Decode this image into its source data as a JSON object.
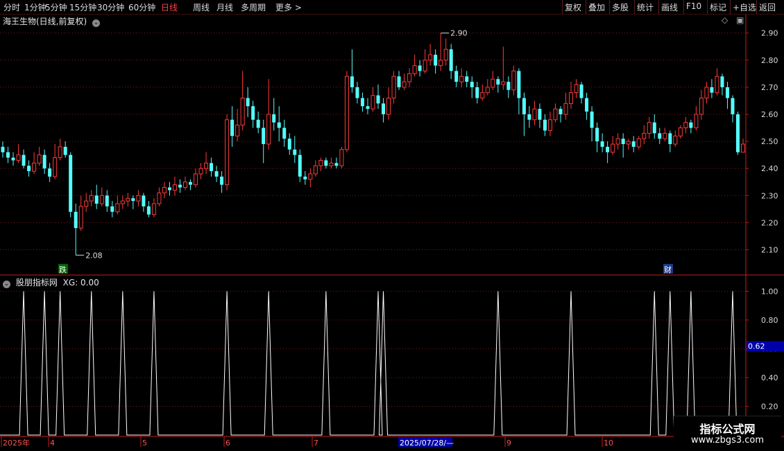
{
  "toolbar": {
    "periods": [
      "分时",
      "1分钟",
      "5分钟",
      "15分钟",
      "30分钟",
      "60分钟",
      "日线",
      "周线",
      "月线",
      "多周期",
      "更多 >"
    ],
    "active_period": "日线",
    "tools": [
      "复权",
      "叠加",
      "多股",
      "统计",
      "画线",
      "F10",
      "标记",
      "+自选",
      "返回"
    ]
  },
  "main_panel": {
    "title": "海王生物(日线,前复权)",
    "high_marker": "2.90",
    "low_marker": "2.08",
    "badge_left": "跌",
    "badge_right": "财"
  },
  "sub_panel": {
    "title": "股朋指标网",
    "indicator": "XG: 0.00",
    "cursor_value": "0.62"
  },
  "time_axis": {
    "labels": [
      "2025年",
      "4",
      "5",
      "6",
      "7",
      "9",
      "10"
    ],
    "cursor_date": "2025/07/28/—"
  },
  "watermark": {
    "line1": "指标公式网",
    "line2": "www.zbgs3.com"
  },
  "colors": {
    "up": "#ff3b3b",
    "down": "#54ffff",
    "grid": "#8b1a1a",
    "axis": "#c81e1e",
    "indicator": "#ffffff",
    "cursor_bg": "#0000aa"
  },
  "chart_data": [
    {
      "type": "candlestick",
      "title": "海王生物(日线,前复权)",
      "ylim": [
        2.05,
        2.93
      ],
      "y_ticks": [
        "2.10",
        "2.20",
        "2.30",
        "2.40",
        "2.50",
        "2.60",
        "2.70",
        "2.80",
        "2.90"
      ],
      "x_ticks": [
        "2025年",
        "4",
        "5",
        "6",
        "7",
        "9",
        "10"
      ],
      "high": 2.9,
      "low": 2.08,
      "candles": [
        [
          2.48,
          2.46,
          2.5,
          2.44
        ],
        [
          2.46,
          2.44,
          2.48,
          2.42
        ],
        [
          2.44,
          2.43,
          2.46,
          2.41
        ],
        [
          2.43,
          2.45,
          2.49,
          2.42
        ],
        [
          2.45,
          2.41,
          2.47,
          2.4
        ],
        [
          2.41,
          2.39,
          2.43,
          2.37
        ],
        [
          2.39,
          2.42,
          2.46,
          2.38
        ],
        [
          2.42,
          2.45,
          2.48,
          2.41
        ],
        [
          2.45,
          2.4,
          2.47,
          2.38
        ],
        [
          2.4,
          2.37,
          2.42,
          2.35
        ],
        [
          2.37,
          2.44,
          2.49,
          2.36
        ],
        [
          2.44,
          2.48,
          2.51,
          2.43
        ],
        [
          2.48,
          2.45,
          2.5,
          2.44
        ],
        [
          2.45,
          2.24,
          2.46,
          2.22
        ],
        [
          2.24,
          2.18,
          2.27,
          2.08
        ],
        [
          2.18,
          2.26,
          2.3,
          2.17
        ],
        [
          2.26,
          2.28,
          2.31,
          2.24
        ],
        [
          2.28,
          2.3,
          2.32,
          2.26
        ],
        [
          2.3,
          2.27,
          2.34,
          2.25
        ],
        [
          2.27,
          2.3,
          2.33,
          2.26
        ],
        [
          2.3,
          2.26,
          2.32,
          2.24
        ],
        [
          2.26,
          2.24,
          2.28,
          2.22
        ],
        [
          2.24,
          2.27,
          2.3,
          2.23
        ],
        [
          2.27,
          2.28,
          2.3,
          2.25
        ],
        [
          2.28,
          2.29,
          2.31,
          2.26
        ],
        [
          2.29,
          2.28,
          2.3,
          2.25
        ],
        [
          2.28,
          2.3,
          2.32,
          2.26
        ],
        [
          2.3,
          2.26,
          2.31,
          2.24
        ],
        [
          2.26,
          2.23,
          2.28,
          2.22
        ],
        [
          2.23,
          2.27,
          2.29,
          2.22
        ],
        [
          2.27,
          2.31,
          2.33,
          2.26
        ],
        [
          2.31,
          2.33,
          2.35,
          2.29
        ],
        [
          2.33,
          2.32,
          2.35,
          2.3
        ],
        [
          2.32,
          2.34,
          2.37,
          2.3
        ],
        [
          2.34,
          2.33,
          2.36,
          2.31
        ],
        [
          2.33,
          2.35,
          2.37,
          2.32
        ],
        [
          2.35,
          2.34,
          2.36,
          2.32
        ],
        [
          2.34,
          2.38,
          2.4,
          2.33
        ],
        [
          2.38,
          2.4,
          2.42,
          2.36
        ],
        [
          2.4,
          2.42,
          2.46,
          2.38
        ],
        [
          2.42,
          2.39,
          2.44,
          2.37
        ],
        [
          2.39,
          2.37,
          2.41,
          2.35
        ],
        [
          2.37,
          2.34,
          2.39,
          2.31
        ],
        [
          2.34,
          2.58,
          2.6,
          2.32
        ],
        [
          2.58,
          2.52,
          2.63,
          2.48
        ],
        [
          2.52,
          2.56,
          2.62,
          2.5
        ],
        [
          2.56,
          2.66,
          2.76,
          2.54
        ],
        [
          2.66,
          2.63,
          2.7,
          2.59
        ],
        [
          2.63,
          2.58,
          2.65,
          2.55
        ],
        [
          2.58,
          2.55,
          2.61,
          2.53
        ],
        [
          2.55,
          2.49,
          2.58,
          2.42
        ],
        [
          2.49,
          2.6,
          2.73,
          2.47
        ],
        [
          2.6,
          2.57,
          2.66,
          2.54
        ],
        [
          2.57,
          2.55,
          2.63,
          2.5
        ],
        [
          2.55,
          2.51,
          2.58,
          2.48
        ],
        [
          2.51,
          2.47,
          2.53,
          2.45
        ],
        [
          2.47,
          2.45,
          2.52,
          2.42
        ],
        [
          2.45,
          2.37,
          2.47,
          2.35
        ],
        [
          2.37,
          2.36,
          2.39,
          2.34
        ],
        [
          2.36,
          2.38,
          2.4,
          2.33
        ],
        [
          2.38,
          2.41,
          2.43,
          2.37
        ],
        [
          2.41,
          2.43,
          2.44,
          2.39
        ],
        [
          2.43,
          2.41,
          2.44,
          2.4
        ],
        [
          2.41,
          2.42,
          2.44,
          2.4
        ],
        [
          2.42,
          2.41,
          2.44,
          2.4
        ],
        [
          2.41,
          2.47,
          2.48,
          2.4
        ],
        [
          2.47,
          2.74,
          2.76,
          2.46
        ],
        [
          2.74,
          2.7,
          2.84,
          2.68
        ],
        [
          2.7,
          2.66,
          2.72,
          2.64
        ],
        [
          2.66,
          2.63,
          2.68,
          2.61
        ],
        [
          2.63,
          2.62,
          2.66,
          2.6
        ],
        [
          2.62,
          2.67,
          2.7,
          2.61
        ],
        [
          2.67,
          2.64,
          2.71,
          2.62
        ],
        [
          2.64,
          2.6,
          2.66,
          2.57
        ],
        [
          2.6,
          2.66,
          2.7,
          2.58
        ],
        [
          2.66,
          2.74,
          2.76,
          2.64
        ],
        [
          2.74,
          2.7,
          2.76,
          2.69
        ],
        [
          2.7,
          2.72,
          2.75,
          2.69
        ],
        [
          2.72,
          2.75,
          2.77,
          2.7
        ],
        [
          2.75,
          2.78,
          2.82,
          2.74
        ],
        [
          2.78,
          2.76,
          2.8,
          2.74
        ],
        [
          2.76,
          2.8,
          2.84,
          2.75
        ],
        [
          2.8,
          2.82,
          2.86,
          2.78
        ],
        [
          2.82,
          2.78,
          2.84,
          2.75
        ],
        [
          2.78,
          2.8,
          2.9,
          2.76
        ],
        [
          2.8,
          2.84,
          2.88,
          2.78
        ],
        [
          2.84,
          2.76,
          2.86,
          2.73
        ],
        [
          2.76,
          2.72,
          2.78,
          2.7
        ],
        [
          2.72,
          2.74,
          2.77,
          2.7
        ],
        [
          2.74,
          2.72,
          2.76,
          2.7
        ],
        [
          2.72,
          2.7,
          2.74,
          2.66
        ],
        [
          2.7,
          2.66,
          2.72,
          2.64
        ],
        [
          2.66,
          2.68,
          2.71,
          2.65
        ],
        [
          2.68,
          2.7,
          2.73,
          2.67
        ],
        [
          2.7,
          2.73,
          2.76,
          2.69
        ],
        [
          2.73,
          2.71,
          2.74,
          2.68
        ],
        [
          2.71,
          2.72,
          2.85,
          2.69
        ],
        [
          2.72,
          2.69,
          2.74,
          2.66
        ],
        [
          2.69,
          2.76,
          2.78,
          2.67
        ],
        [
          2.76,
          2.66,
          2.77,
          2.6
        ],
        [
          2.66,
          2.6,
          2.68,
          2.52
        ],
        [
          2.6,
          2.58,
          2.63,
          2.55
        ],
        [
          2.58,
          2.62,
          2.65,
          2.56
        ],
        [
          2.62,
          2.58,
          2.64,
          2.55
        ],
        [
          2.58,
          2.54,
          2.6,
          2.52
        ],
        [
          2.54,
          2.58,
          2.61,
          2.52
        ],
        [
          2.58,
          2.62,
          2.64,
          2.57
        ],
        [
          2.62,
          2.6,
          2.63,
          2.57
        ],
        [
          2.6,
          2.64,
          2.68,
          2.58
        ],
        [
          2.64,
          2.68,
          2.72,
          2.62
        ],
        [
          2.68,
          2.71,
          2.73,
          2.66
        ],
        [
          2.71,
          2.66,
          2.72,
          2.64
        ],
        [
          2.66,
          2.61,
          2.68,
          2.58
        ],
        [
          2.61,
          2.55,
          2.63,
          2.5
        ],
        [
          2.55,
          2.5,
          2.57,
          2.46
        ],
        [
          2.5,
          2.48,
          2.53,
          2.46
        ],
        [
          2.48,
          2.46,
          2.5,
          2.42
        ],
        [
          2.46,
          2.49,
          2.52,
          2.45
        ],
        [
          2.49,
          2.51,
          2.53,
          2.47
        ],
        [
          2.51,
          2.49,
          2.53,
          2.44
        ],
        [
          2.49,
          2.5,
          2.51,
          2.47
        ],
        [
          2.5,
          2.48,
          2.52,
          2.46
        ],
        [
          2.48,
          2.51,
          2.52,
          2.47
        ],
        [
          2.51,
          2.53,
          2.56,
          2.49
        ],
        [
          2.53,
          2.57,
          2.59,
          2.51
        ],
        [
          2.57,
          2.53,
          2.6,
          2.51
        ],
        [
          2.53,
          2.51,
          2.55,
          2.49
        ],
        [
          2.51,
          2.53,
          2.55,
          2.5
        ],
        [
          2.53,
          2.49,
          2.54,
          2.46
        ],
        [
          2.49,
          2.52,
          2.54,
          2.48
        ],
        [
          2.52,
          2.55,
          2.56,
          2.51
        ],
        [
          2.55,
          2.57,
          2.59,
          2.53
        ],
        [
          2.57,
          2.55,
          2.58,
          2.53
        ],
        [
          2.55,
          2.6,
          2.63,
          2.54
        ],
        [
          2.6,
          2.66,
          2.69,
          2.58
        ],
        [
          2.66,
          2.7,
          2.72,
          2.64
        ],
        [
          2.7,
          2.68,
          2.73,
          2.66
        ],
        [
          2.68,
          2.74,
          2.77,
          2.67
        ],
        [
          2.74,
          2.7,
          2.75,
          2.67
        ],
        [
          2.7,
          2.66,
          2.72,
          2.62
        ],
        [
          2.66,
          2.6,
          2.67,
          2.57
        ],
        [
          2.6,
          2.46,
          2.61,
          2.45
        ],
        [
          2.46,
          2.49,
          2.51,
          2.46
        ]
      ]
    },
    {
      "type": "line",
      "title": "股朋指标网",
      "series": [
        {
          "name": "XG",
          "values_note": "spike indicator",
          "spike_positions": [
            4,
            8,
            11,
            17,
            23,
            29,
            43,
            51,
            62,
            72,
            73,
            95,
            109,
            125,
            128,
            132,
            140
          ]
        }
      ],
      "ylim": [
        0,
        1.05
      ],
      "y_ticks": [
        "0.20",
        "0.40",
        "0.60",
        "0.80",
        "1.00"
      ]
    }
  ]
}
